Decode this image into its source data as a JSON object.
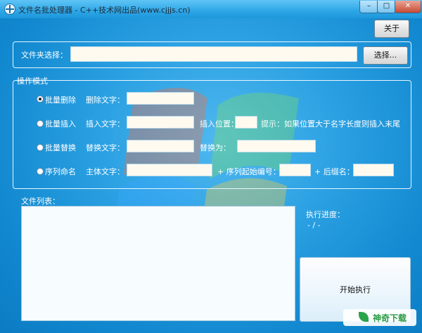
{
  "window": {
    "title": "文件名批处理器 - C++技术网出品(www.cjjjs.cn)",
    "minimize_glyph": "–",
    "maximize_glyph": "□",
    "close_glyph": "✕"
  },
  "toolbar": {
    "about_label": "关于"
  },
  "folder": {
    "label": "文件夹选择：",
    "path_value": "",
    "browse_label": "选择..."
  },
  "mode": {
    "legend": "操作模式",
    "delete": {
      "label": "批量删除",
      "field_label": "删除文字：",
      "text_value": "",
      "checked": true
    },
    "insert": {
      "label": "批量插入",
      "field_label": "插入文字：",
      "text_value": "",
      "position_label": "插入位置：",
      "position_value": "",
      "hint": "提示：如果位置大于名字长度则插入末尾",
      "checked": false
    },
    "replace": {
      "label": "批量替换",
      "field_label": "替换文字：",
      "text_value": "",
      "with_label": "替换为：",
      "with_value": "",
      "checked": false
    },
    "sequence": {
      "label": "序列命名",
      "field_label": "主体文字：",
      "text_value": "",
      "start_label": "+ 序列起始编号：",
      "start_value": "",
      "suffix_label": "+ 后缀名：",
      "suffix_value": "",
      "checked": false
    }
  },
  "files": {
    "label": "文件列表："
  },
  "progress": {
    "label": "执行进度：",
    "value": "- / -"
  },
  "start": {
    "label": "开始执行"
  },
  "watermark": {
    "brand": "神奇下载",
    "leaf_color": "#2aa44a"
  },
  "colors": {
    "window_blue": "#1a8fd0",
    "field_bg": "#fffaf0"
  }
}
